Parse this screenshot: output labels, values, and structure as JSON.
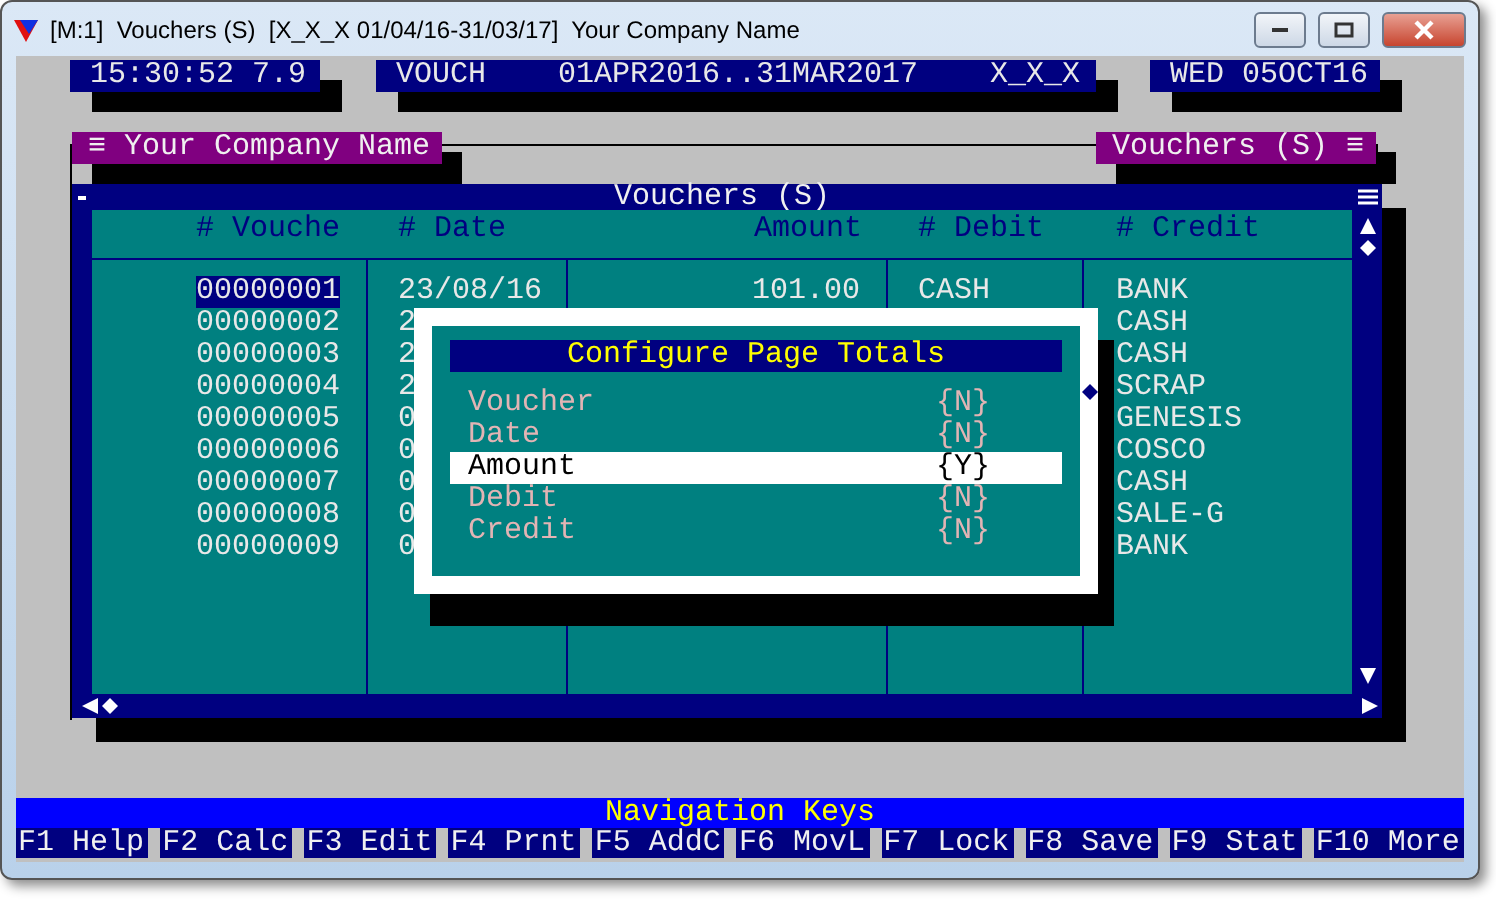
{
  "window": {
    "title": "[M:1]  Vouchers (S)  [X_X_X 01/04/16-31/03/17]  Your Company Name"
  },
  "status": [
    "15:30:52 7.9",
    "VOUCH    01APR2016..31MAR2017    X_X_X",
    "WED 05OCT16"
  ],
  "company_bar": {
    "left": "≡ Your Company Name",
    "right": "Vouchers (S) ≡"
  },
  "table": {
    "title": "Vouchers (S)",
    "columns": [
      "# Vouche",
      "# Date",
      "Amount",
      "# Debit",
      "# Credit"
    ],
    "rows": [
      {
        "voucher": "00000001",
        "date": "23/08/16",
        "amount": "101.00",
        "debit": "CASH",
        "credit": "BANK",
        "selected": true
      },
      {
        "voucher": "00000002",
        "date": "2",
        "credit": "CASH",
        "selected": false
      },
      {
        "voucher": "00000003",
        "date": "2",
        "credit": "CASH",
        "selected": false
      },
      {
        "voucher": "00000004",
        "date": "2",
        "credit": "SCRAP",
        "selected": false
      },
      {
        "voucher": "00000005",
        "date": "0",
        "credit": "GENESIS",
        "selected": false
      },
      {
        "voucher": "00000006",
        "date": "0",
        "credit": "COSCO",
        "selected": false
      },
      {
        "voucher": "00000007",
        "date": "0",
        "credit": "CASH",
        "selected": false
      },
      {
        "voucher": "00000008",
        "date": "0",
        "credit": "SALE-G",
        "selected": false
      },
      {
        "voucher": "00000009",
        "date": "0",
        "credit": "BANK",
        "selected": false
      }
    ]
  },
  "dialog": {
    "title": "Configure Page Totals",
    "items": [
      {
        "label": "Voucher",
        "value": "{N}",
        "selected": false
      },
      {
        "label": "Date",
        "value": "{N}",
        "selected": false
      },
      {
        "label": "Amount",
        "value": "{Y}",
        "selected": true
      },
      {
        "label": "Debit",
        "value": "{N}",
        "selected": false
      },
      {
        "label": "Credit",
        "value": "{N}",
        "selected": false
      }
    ]
  },
  "nav": {
    "title": "Navigation Keys",
    "keys": [
      "F1 Help",
      "F2 Calc",
      "F3 Edit",
      "F4 Prnt",
      "F5 AddC",
      "F6 MovL",
      "F7 Lock",
      "F8 Save",
      "F9 Stat",
      "F10 More"
    ]
  }
}
